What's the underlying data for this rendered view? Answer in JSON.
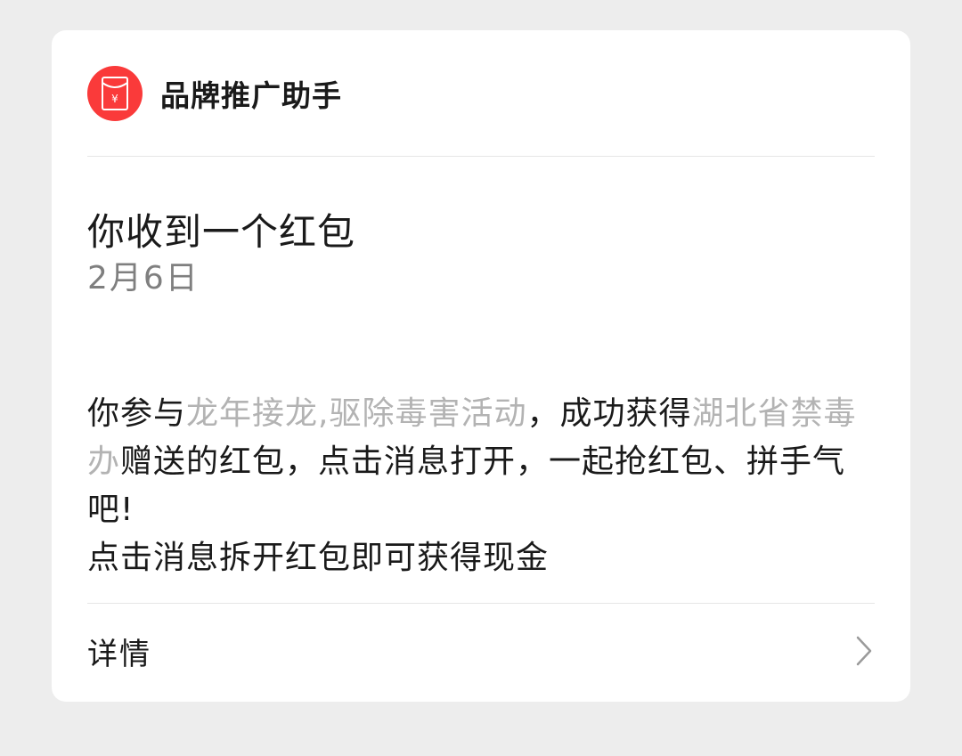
{
  "header": {
    "avatar_icon": "red-envelope-icon",
    "brand_name": "品牌推广助手",
    "accent_color": "#fa3a3a"
  },
  "notification": {
    "title": "你收到一个红包",
    "date": "2月6日"
  },
  "message": {
    "part1": "你参与",
    "activity": "龙年接龙,驱除毒害活动",
    "part2": "，成功获得",
    "sender": "湖北省禁毒办",
    "part3": "赠送的红包，点击消息打开，一起抢红包、拼手气吧!",
    "line2": "点击消息拆开红包即可获得现金"
  },
  "footer": {
    "details_label": "详情",
    "chevron_icon": "chevron-right-icon"
  }
}
